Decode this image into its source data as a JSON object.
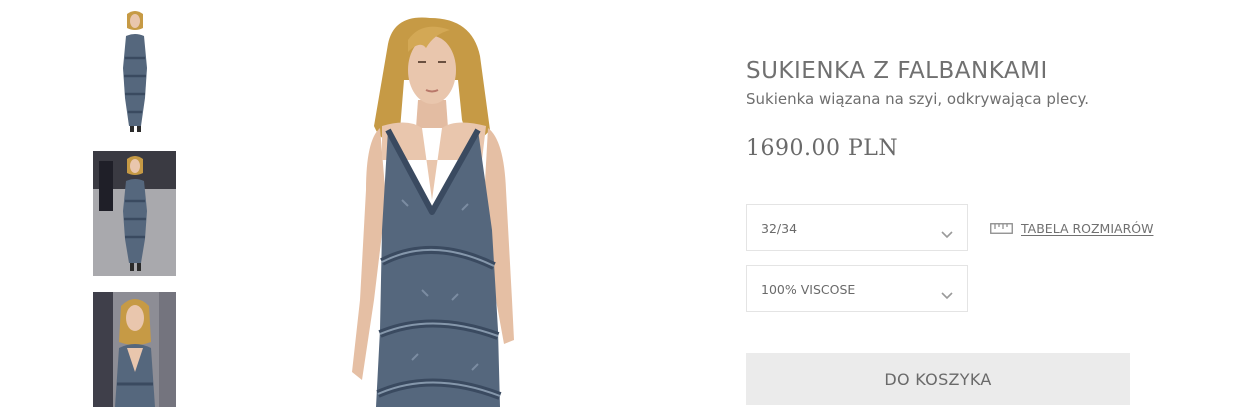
{
  "product": {
    "title": "SUKIENKA Z FALBANKAMI",
    "description": "Sukienka wiązana na szyi, odkrywająca plecy.",
    "price": "1690.00 PLN"
  },
  "options": {
    "size_selected": "32/34",
    "material_selected": "100% VISCOSE",
    "size_chart_label": "TABELA ROZMIARÓW"
  },
  "cart": {
    "add_label": "DO KOSZYKA"
  },
  "colors": {
    "denim": "#55677d",
    "denim_dark": "#3a4a60",
    "hair": "#c69a45",
    "skin": "#e9c6ad",
    "runway_bg": "#9a9a9f",
    "button_bg": "#ebebeb",
    "text": "#6e6e6e"
  },
  "icons": {
    "select_arrow": "chevron-down-icon",
    "size_chart": "ruler-icon"
  }
}
